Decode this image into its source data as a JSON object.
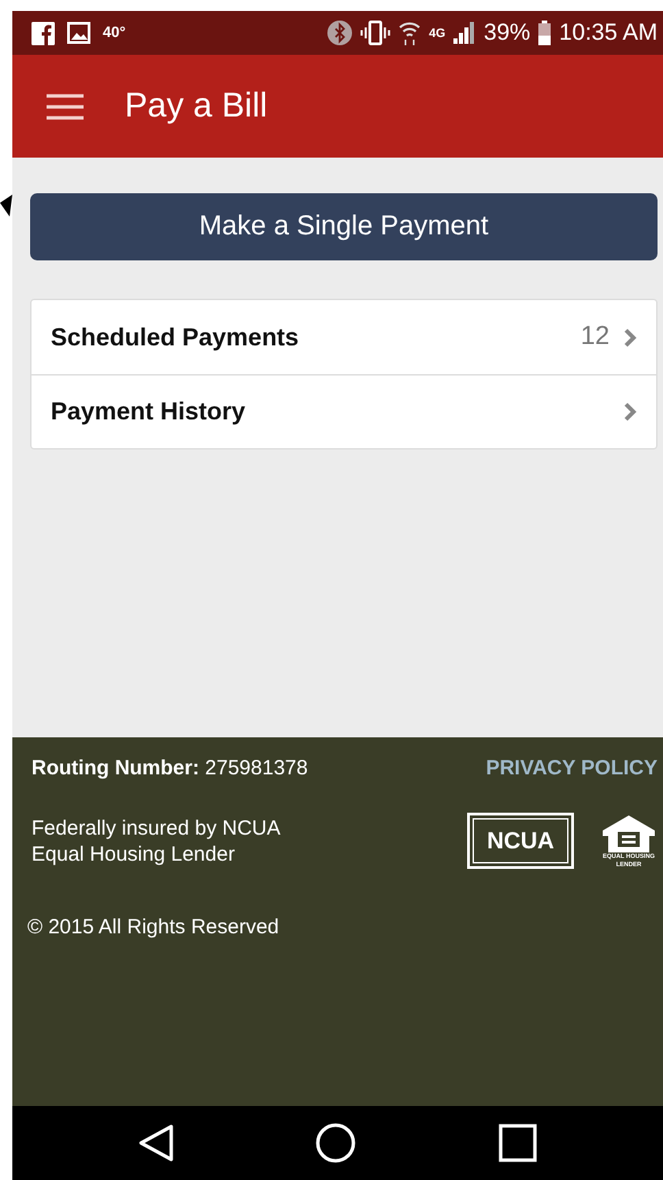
{
  "status_bar": {
    "temperature": "40°",
    "network": "4G",
    "battery": "39%",
    "time": "10:35 AM"
  },
  "header": {
    "title": "Pay a Bill"
  },
  "primary_button": {
    "label": "Make a Single Payment"
  },
  "menu_items": [
    {
      "label": "Scheduled Payments",
      "count": "12"
    },
    {
      "label": "Payment History"
    }
  ],
  "footer": {
    "routing": "**Routing Number:** 275981378",
    "privacy_link": "PRIVACY POLICY",
    "insurance_lines": [
      "Federally insured by NCUA",
      "Equal Housing Lender"
    ],
    "ncua_logo": "NCUA",
    "housing_logo": [
      "EQUAL HOUSING",
      "LENDER"
    ],
    "copyright": "© 2015 All Rights Reserved"
  }
}
